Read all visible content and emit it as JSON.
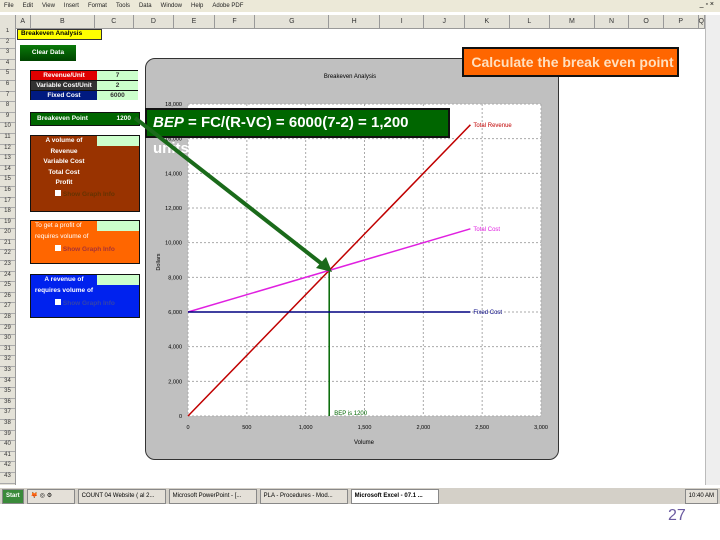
{
  "menu": [
    "File",
    "Edit",
    "View",
    "Insert",
    "Format",
    "Tools",
    "Data",
    "Window",
    "Help",
    "Adobe PDF"
  ],
  "window_controls": "_ ▫ ×",
  "columns": [
    "A",
    "B",
    "C",
    "D",
    "E",
    "F",
    "G",
    "H",
    "I",
    "J",
    "K",
    "L",
    "M",
    "N",
    "O",
    "P",
    "Q"
  ],
  "sheet": {
    "title": "Breakeven Analysis",
    "clear_button": "Clear Data",
    "inputs": [
      {
        "label": "Revenue/Unit",
        "value": "7",
        "color": "#e00000"
      },
      {
        "label": "Variable Cost/Unit",
        "value": "2",
        "color": "#333333"
      },
      {
        "label": "Fixed Cost",
        "value": "6000",
        "color": "#001a80"
      }
    ],
    "breakeven": {
      "label": "Breakeven Point",
      "value": "1200"
    },
    "brown_panel": {
      "lines": [
        "A volume of",
        "Revenue",
        "Variable Cost",
        "Total Cost",
        "Profit"
      ],
      "checkbox": "Show Graph Info"
    },
    "orange_panel": {
      "lines": [
        "To get a profit of",
        "requires volume of"
      ],
      "checkbox": "Show Graph Info"
    },
    "blue_panel": {
      "lines": [
        "A revenue of",
        "requires volume of"
      ],
      "checkbox": "Show Graph Info"
    }
  },
  "chart_data": {
    "type": "line",
    "title": "Breakeven Analysis",
    "xlabel": "Volume",
    "ylabel": "Dollars",
    "xlim": [
      0,
      3000
    ],
    "ylim": [
      0,
      18000
    ],
    "x_ticks": [
      "0",
      "500",
      "1,000",
      "1,500",
      "2,000",
      "2,500",
      "3,000"
    ],
    "y_ticks": [
      "0",
      "2,000",
      "4,000",
      "6,000",
      "8,000",
      "10,000",
      "12,000",
      "14,000",
      "16,000",
      "18,000"
    ],
    "grid": true,
    "series": [
      {
        "name": "Total Revenue",
        "x": [
          0,
          2400
        ],
        "y": [
          0,
          16800
        ],
        "color": "#c00000"
      },
      {
        "name": "Total Cost",
        "x": [
          0,
          2400
        ],
        "y": [
          6000,
          10800
        ],
        "color": "#e020e0"
      },
      {
        "name": "Fixed Cost",
        "x": [
          0,
          2400
        ],
        "y": [
          6000,
          6000
        ],
        "color": "#000080"
      }
    ],
    "bep": {
      "x": 1200,
      "y": 8400,
      "label": "BEP is 1200",
      "color": "#006600"
    }
  },
  "callout": "Calculate the break even point",
  "formula": {
    "italic": "BEP",
    "rest": " = FC/(R-VC) = 6000(7-2) = 1,200 units"
  },
  "taskbar": {
    "start": "Start",
    "items": [
      "COUNT 04 Website ( al 2...",
      "Microsoft PowerPoint - [...",
      "PLA - Procedures - Mod...",
      "Microsoft Excel - 07.1 ..."
    ],
    "clock": "10:40 AM"
  },
  "page_number": "27"
}
